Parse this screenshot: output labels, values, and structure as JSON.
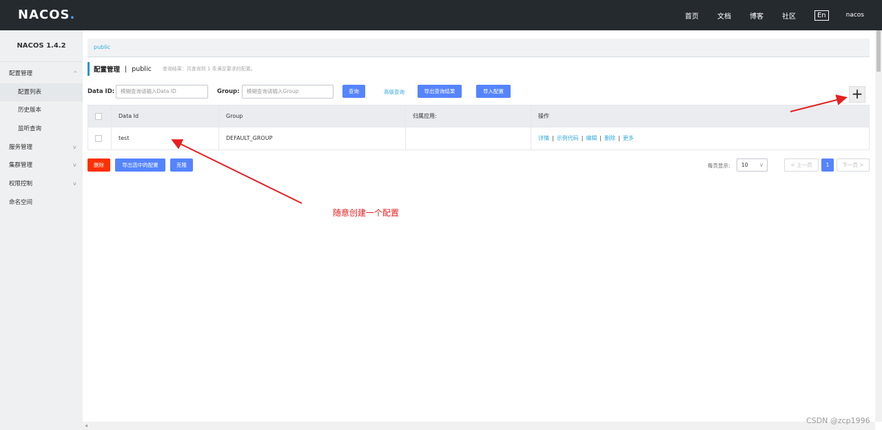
{
  "app": {
    "logo": "NACOS",
    "logo_dot": "."
  },
  "topnav": {
    "items": [
      "首页",
      "文档",
      "博客",
      "社区"
    ],
    "lang": "En",
    "user": "nacos"
  },
  "sidebar": {
    "version": "NACOS 1.4.2",
    "items": [
      {
        "label": "配置管理"
      },
      {
        "label": "配置列表"
      },
      {
        "label": "历史版本"
      },
      {
        "label": "监听查询"
      },
      {
        "label": "服务管理"
      },
      {
        "label": "集群管理"
      },
      {
        "label": "权限控制"
      },
      {
        "label": "命名空间"
      }
    ]
  },
  "breadcrumb": {
    "namespace": "public"
  },
  "page": {
    "title": "配置管理",
    "separator": "|",
    "namespace": "public",
    "hint": "查询结果：共查询到 1 条满足要求的配置。"
  },
  "search": {
    "data_id_label": "Data ID:",
    "data_id_placeholder": "模糊查询请输入Data ID",
    "group_label": "Group:",
    "group_placeholder": "模糊查询请输入Group",
    "query_button": "查询",
    "advanced_link": "高级查询",
    "export_button": "导出查询结果",
    "import_button": "导入配置",
    "add_button": "+"
  },
  "table": {
    "headers": [
      "Data Id",
      "Group",
      "归属应用:",
      "操作"
    ],
    "rows": [
      {
        "data_id": "test",
        "group": "DEFAULT_GROUP",
        "app": "",
        "ops": [
          "详情",
          "示例代码",
          "编辑",
          "删除"
        ],
        "more": "更多"
      }
    ],
    "separator": "|"
  },
  "bottom": {
    "delete_button": "删除",
    "export_selected_button": "导出选中的配置",
    "clone_button": "克隆",
    "page_size_label": "每页显示:",
    "page_size": "10",
    "prev": "< 上一页",
    "current_page": "1",
    "next": "下一页 >"
  },
  "annotation": {
    "text": "随意创建一个配置",
    "color": "#e61f1f"
  },
  "watermark": "CSDN @zcp1996",
  "colors": {
    "primary": "#5584ff",
    "danger": "#ff3000",
    "link": "#33aadd",
    "topbar": "#252a2f"
  }
}
